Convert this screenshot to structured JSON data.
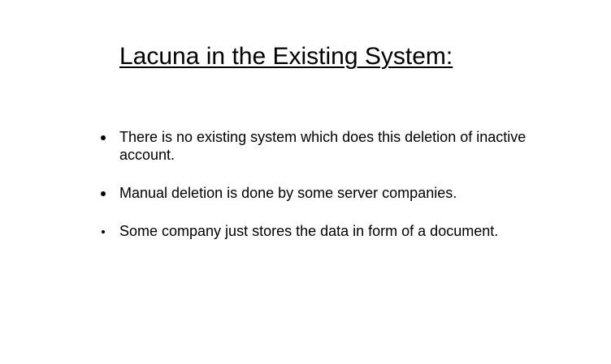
{
  "slide": {
    "title": "Lacuna in the Existing System:",
    "bullets": [
      {
        "text": "There is no existing system which does this deletion of inactive account."
      },
      {
        "text": "Manual deletion is done by some server companies."
      },
      {
        "text": "Some company just stores the data in form of a document."
      }
    ]
  }
}
